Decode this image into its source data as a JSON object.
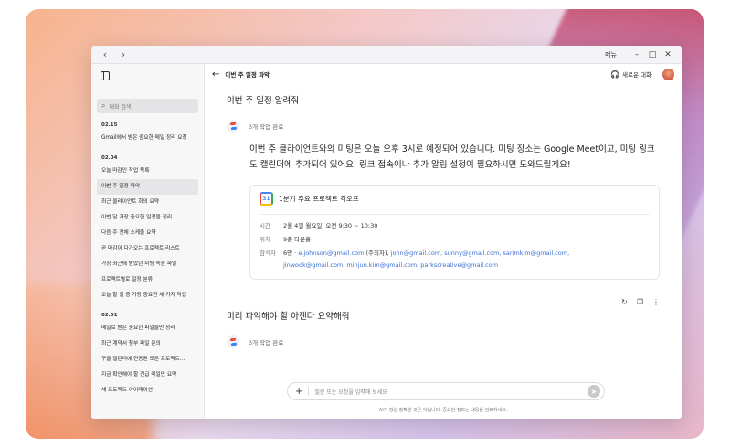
{
  "titlebar": {
    "back": "‹",
    "forward": "›",
    "menu_label": "메뉴",
    "minimize": "–",
    "maximize": "□",
    "close": "✕"
  },
  "sidebar": {
    "search_placeholder": "대화 검색",
    "groups": [
      {
        "date": "02.15",
        "items": [
          "Gmail에서 받은 중요한 메일 정리 요청"
        ]
      },
      {
        "date": "02.04",
        "items": [
          "오늘 마감인 작업 목록",
          "이번 주 일정 파악",
          "최근 클라이언트 회의 요약",
          "이번 달 가장 중요한 일정을 정리",
          "다음 주 전체 스케줄 요약",
          "곧 마감이 다가오는 프로젝트 리스트",
          "가장 최근에 받았던 미팅 녹음 파일",
          "프로젝트별로 일정 분류",
          "오늘 할 일 중 가장 중요한 세 가지 작업"
        ]
      },
      {
        "date": "02.01",
        "items": [
          "메일로 받은 중요한 파일들만 정리",
          "최근 계약서 첨부 파일 문의",
          "구글 캘린더에 연동된 모든 프로젝트...",
          "지금 확인해야 할 긴급 메일만 요약",
          "새 프로젝트 아이데이션"
        ]
      }
    ]
  },
  "topbar": {
    "back_icon": "←",
    "title": "이번 주 일정 파악",
    "new_chat": "새로운 대화",
    "new_chat_icon": "🎧"
  },
  "chat": {
    "user_q1": "이번 주 일정 알려줘",
    "task_done": "3개 작업 완료",
    "answer": "이번 주 클라이언트와의 미팅은 오늘 오후 3시로 예정되어 있습니다. 미팅 장소는 Google Meet이고, 미팅 링크도 캘린더에 추가되어 있어요. 링크 접속이나 추가 알림 설정이 필요하시면 도와드릴게요!",
    "event": {
      "cal_day": "31",
      "title": "1분기 주요 프로젝트 킥오프",
      "time_label": "시간",
      "time": "2월 4일 월요일, 오전 9:30 ~ 10:30",
      "place_label": "위치",
      "place": "9층 타운홀",
      "att_label": "참석자",
      "att_count": "6명 ·",
      "attendees_line1": "e.johnson@gmail.com",
      "organizer": "(주최자),",
      "attendees_line1b": "john@gmail.com, sunny@gmail.com, sarimkim@gmail.com,",
      "attendees_line2": "jinwook@gmail.com, minjun.kim@gmail.com, parkscreative@gmail.com"
    },
    "user_q2": "미리 파악해야 할 아젠다 요약해줘",
    "task_done2": "3개 작업 완료"
  },
  "composer": {
    "plus": "+",
    "placeholder": "질문 또는 요청을 입력해 보세요",
    "send": "➤"
  },
  "disclaimer": "AI가 항상 정확한 것은 아닙니다. 중요한 정보는 내용을 검토하세요.",
  "colors": {
    "accent_link": "#3b6fd4",
    "active_item": "#e6e6e8"
  }
}
